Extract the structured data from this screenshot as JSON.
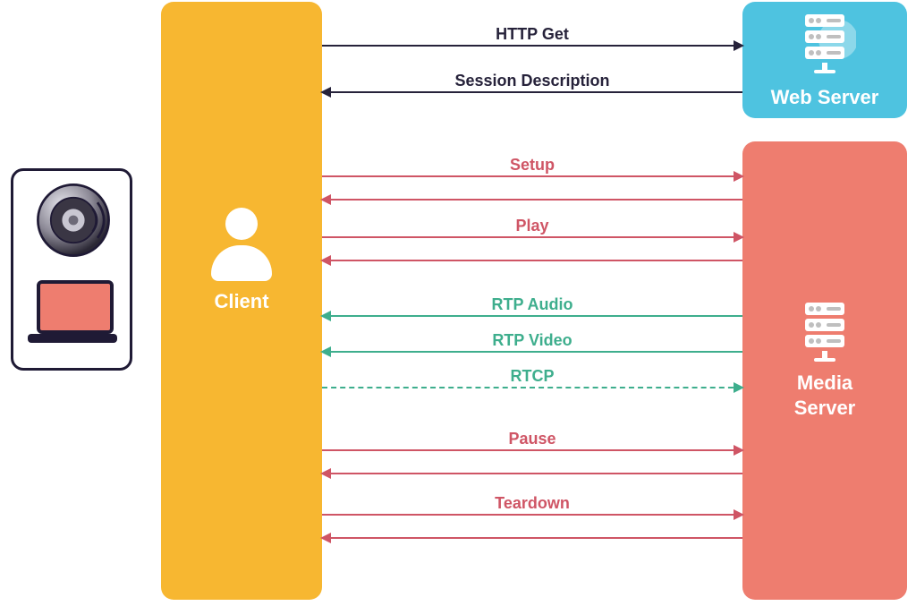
{
  "colors": {
    "client": "#f7b731",
    "webserver": "#4ec3e0",
    "mediaserver": "#ee7d6f",
    "device_border": "#1f1a35",
    "arrow_dark": "#26223a",
    "arrow_red": "#cf5565",
    "arrow_green": "#3eae8d"
  },
  "nodes": {
    "client": {
      "label": "Client"
    },
    "webserver": {
      "label": "Web Server"
    },
    "mediaserver": {
      "label": "Media\nServer",
      "label_line1": "Media",
      "label_line2": "Server"
    }
  },
  "devices": {
    "speaker_icon": "speaker-icon",
    "laptop_icon": "laptop-icon"
  },
  "flows": [
    {
      "id": "http_get",
      "label": "HTTP Get",
      "from": "client",
      "to": "webserver",
      "direction": "right",
      "color": "dark",
      "style": "solid",
      "response": false
    },
    {
      "id": "sess_desc",
      "label": "Session Description",
      "from": "webserver",
      "to": "client",
      "direction": "left",
      "color": "dark",
      "style": "solid",
      "response": true
    },
    {
      "id": "setup",
      "label": "Setup",
      "from": "client",
      "to": "mediaserver",
      "direction": "right",
      "color": "red",
      "style": "solid",
      "response": true
    },
    {
      "id": "play",
      "label": "Play",
      "from": "client",
      "to": "mediaserver",
      "direction": "right",
      "color": "red",
      "style": "solid",
      "response": true
    },
    {
      "id": "rtp_audio",
      "label": "RTP Audio",
      "from": "mediaserver",
      "to": "client",
      "direction": "left",
      "color": "green",
      "style": "solid",
      "response": false
    },
    {
      "id": "rtp_video",
      "label": "RTP Video",
      "from": "mediaserver",
      "to": "client",
      "direction": "left",
      "color": "green",
      "style": "solid",
      "response": false
    },
    {
      "id": "rtcp",
      "label": "RTCP",
      "from": "client",
      "to": "mediaserver",
      "direction": "right",
      "color": "green",
      "style": "dashed",
      "response": false
    },
    {
      "id": "pause",
      "label": "Pause",
      "from": "client",
      "to": "mediaserver",
      "direction": "right",
      "color": "red",
      "style": "solid",
      "response": true
    },
    {
      "id": "teardown",
      "label": "Teardown",
      "from": "client",
      "to": "mediaserver",
      "direction": "right",
      "color": "red",
      "style": "solid",
      "response": true
    }
  ]
}
